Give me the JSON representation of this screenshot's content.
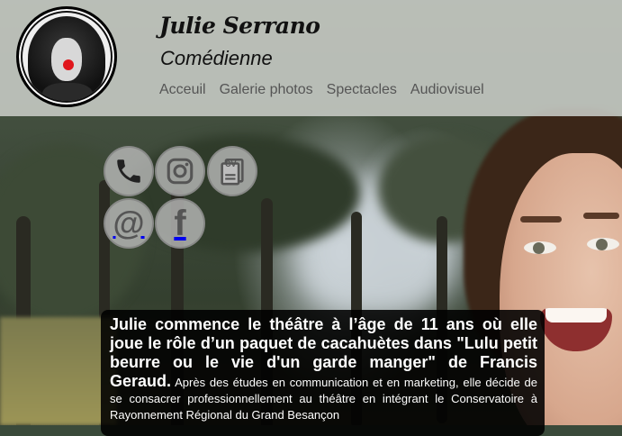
{
  "header": {
    "title": "Julie Serrano",
    "subtitle": "Comédienne",
    "nav": [
      {
        "label": "Acceuil"
      },
      {
        "label": "Galerie photos"
      },
      {
        "label": "Spectacles"
      },
      {
        "label": "Audiovisuel"
      }
    ]
  },
  "social": [
    {
      "name": "phone-icon"
    },
    {
      "name": "instagram-icon"
    },
    {
      "name": "cv-icon",
      "label": "CV"
    },
    {
      "name": "email-icon",
      "label": "@"
    },
    {
      "name": "facebook-icon",
      "label": "f"
    }
  ],
  "bio": {
    "intro": "Julie commence le théâtre à l’âge de 11 ans où elle joue le rôle d’un paquet de cacahuètes dans \"Lulu petit beurre ou le vie d'un garde manger\" de Francis Geraud.",
    "rest": " Après des études en communication et en marketing, elle décide de se consacrer professionnellement au théâtre en intégrant le Conservatoire à Rayonnement Régional du Grand Besançon"
  },
  "colors": {
    "header_bg": "#c8ccc6",
    "avatar_nose": "#e0161c",
    "text_box_bg": "#000000"
  }
}
